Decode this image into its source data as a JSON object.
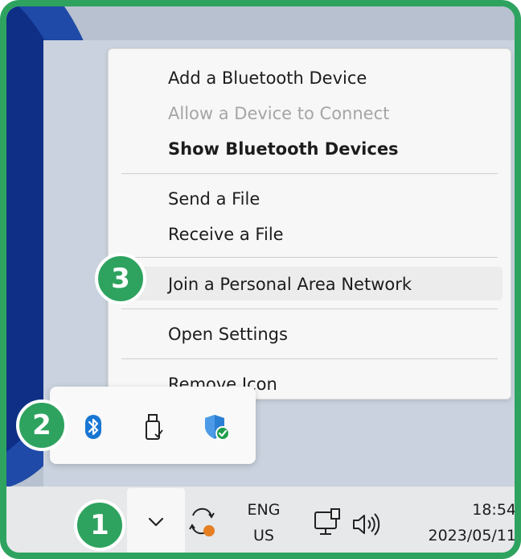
{
  "context_menu": {
    "items": [
      {
        "label": "Add a Bluetooth Device",
        "state": "normal"
      },
      {
        "label": "Allow a Device to Connect",
        "state": "disabled"
      },
      {
        "label": "Show Bluetooth Devices",
        "state": "default"
      },
      {
        "label": "Send a File",
        "state": "normal"
      },
      {
        "label": "Receive a File",
        "state": "normal"
      },
      {
        "label": "Join a Personal Area Network",
        "state": "highlighted"
      },
      {
        "label": "Open Settings",
        "state": "normal"
      },
      {
        "label": "Remove Icon",
        "state": "normal"
      }
    ]
  },
  "tray_flyout": {
    "icons": [
      "bluetooth-icon",
      "usb-eject-icon",
      "windows-security-icon"
    ]
  },
  "taskbar": {
    "show_hidden_icons": "chevron-up-icon",
    "sync_icon": "sync-pending-icon",
    "language_line1": "ENG",
    "language_line2": "US",
    "network_icon": "network-wired-icon",
    "volume_icon": "volume-icon",
    "time": "18:54",
    "date": "2023/05/11"
  },
  "callouts": [
    "1",
    "2",
    "3"
  ],
  "colors": {
    "callout": "#2ea35f",
    "bluetooth": "#1976d2",
    "security_shield": "#2b7fd4",
    "security_check": "#1e9e4a",
    "sync_dot": "#e67e22"
  }
}
